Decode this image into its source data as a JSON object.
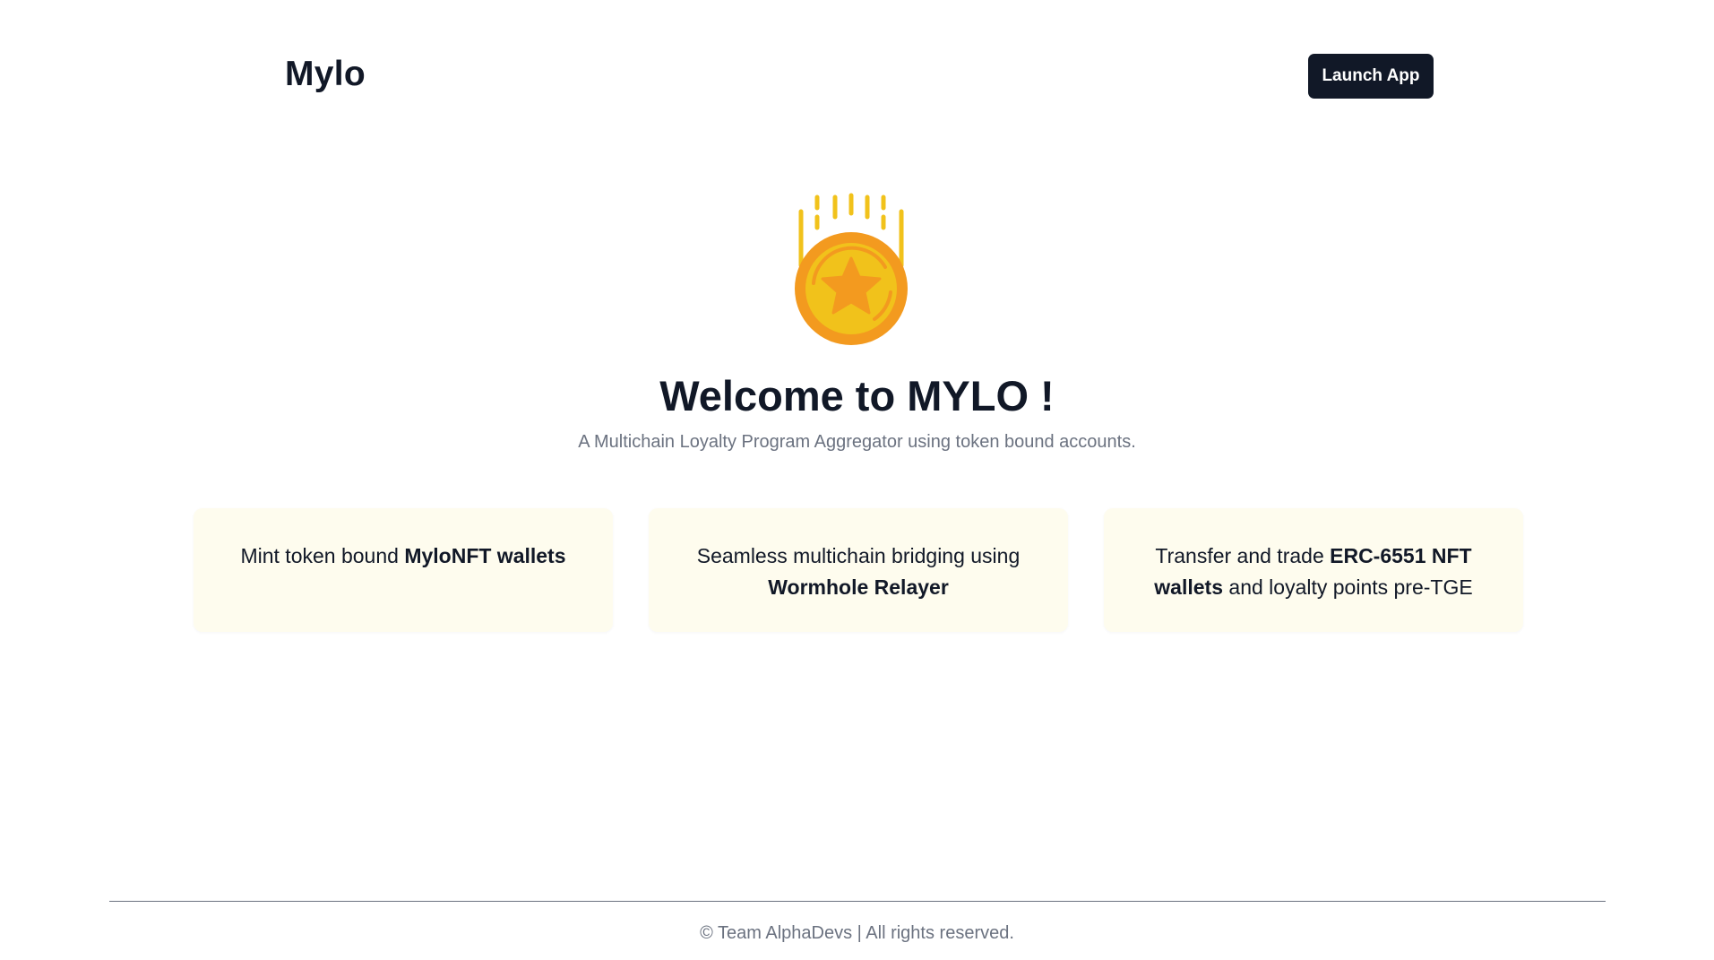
{
  "header": {
    "brand": "Mylo",
    "launch_button_label": "Launch App"
  },
  "hero": {
    "icon": "star-coin-icon",
    "title": "Welcome to MYLO !",
    "subtitle": "A Multichain Loyalty Program Aggregator using token bound accounts."
  },
  "features": [
    {
      "before": "Mint token bound ",
      "bold": "MyloNFT wallets",
      "after": ""
    },
    {
      "before": "Seamless multichain bridging using ",
      "bold": "Wormhole Relayer",
      "after": ""
    },
    {
      "before": "Transfer and trade ",
      "bold": "ERC-6551 NFT wallets",
      "after": " and loyalty points pre-TGE"
    }
  ],
  "footer": {
    "text": "© Team AlphaDevs | All rights reserved."
  },
  "colors": {
    "primary_dark": "#111827",
    "muted_text": "#6b7280",
    "card_background": "#fefcee",
    "coin_yellow": "#f1c21b",
    "coin_orange": "#f39a1f"
  }
}
